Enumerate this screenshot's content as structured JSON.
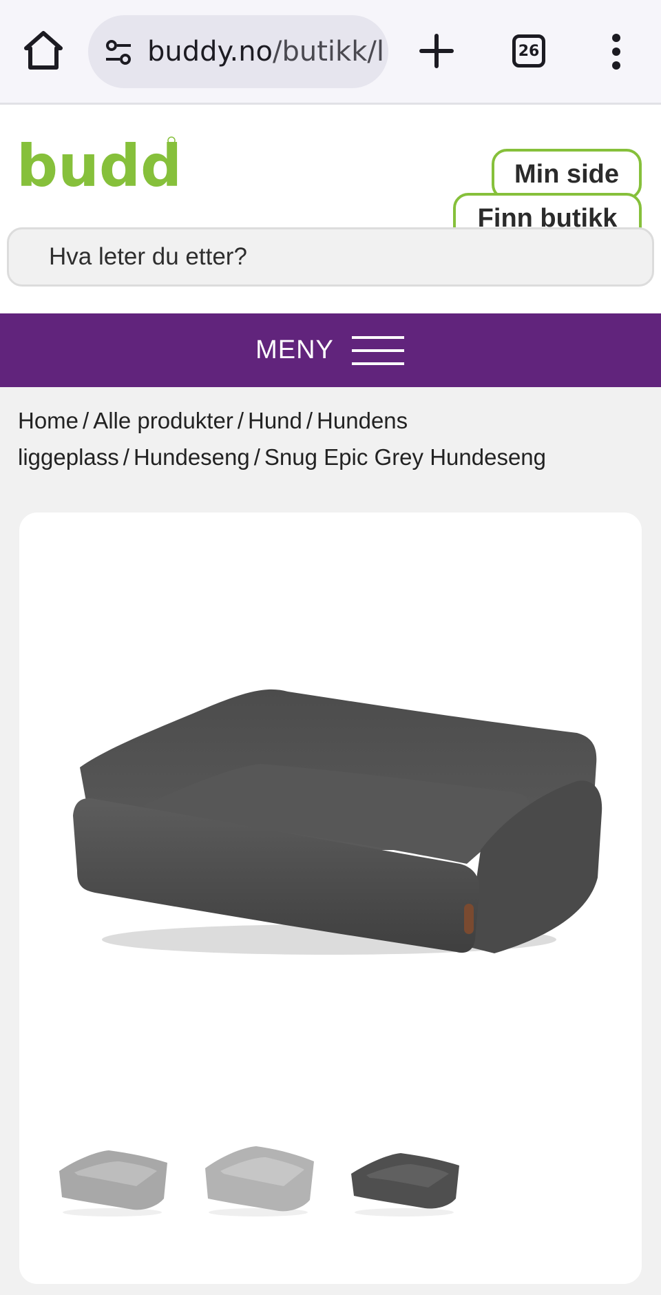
{
  "browser": {
    "url_domain": "buddy.no",
    "url_path": "/butikk/l",
    "tab_count": "26",
    "icons": [
      "home-icon",
      "tune-icon",
      "plus-icon",
      "tabs-icon",
      "more-vert-icon"
    ]
  },
  "header": {
    "logo_text": "buddy",
    "min_side_label": "Min side",
    "finn_butikk_label": "Finn butikk",
    "search_placeholder": "Hva leter du etter?",
    "colors": {
      "brand_green": "#86c03b",
      "menu_purple": "#61247c"
    }
  },
  "menu": {
    "label": "MENY"
  },
  "breadcrumb": {
    "items": [
      "Home",
      "Alle produkter",
      "Hund",
      "Hundens liggeplass",
      "Hundeseng",
      "Snug Epic Grey Hundeseng"
    ],
    "separator": "/"
  },
  "product": {
    "name": "Snug Epic Grey Hundeseng",
    "gallery": [
      {
        "color": "light grey",
        "shade": "#a8a8a8"
      },
      {
        "color": "light grey",
        "shade": "#b3b3b3"
      },
      {
        "color": "dark grey",
        "shade": "#555555"
      }
    ]
  }
}
